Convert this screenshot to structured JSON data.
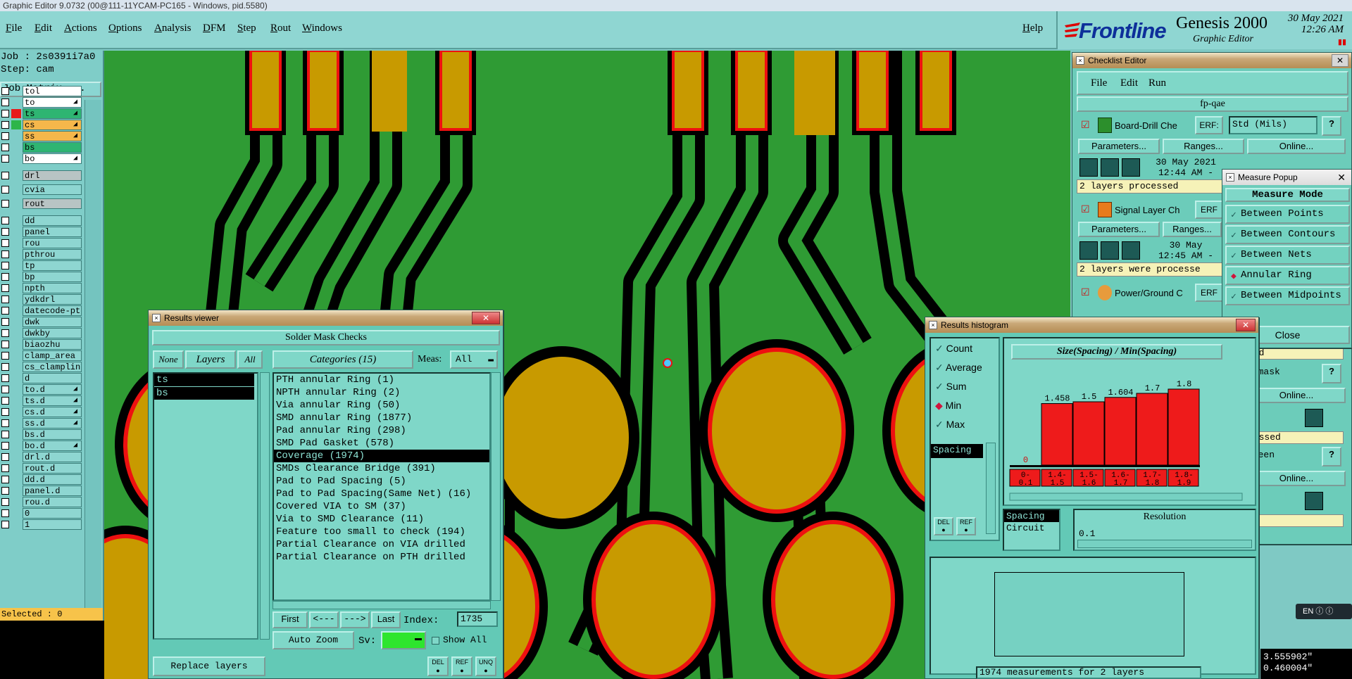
{
  "titlebar": "Graphic Editor 9.0732 (00@111-11YCAM-PC165 - Windows, pid.5580)",
  "menu": [
    "File",
    "Edit",
    "Actions",
    "Options",
    "Analysis",
    "DFM",
    "Step",
    "Rout",
    "Windows"
  ],
  "help": "Help",
  "brand": {
    "logo": "Frontline",
    "product": "Genesis 2000",
    "subtitle": "Graphic Editor",
    "date": "30 May 2021",
    "time": "12:26 AM"
  },
  "left": {
    "job": "Job : 2s0391i7a0",
    "step": "Step: cam",
    "job_matrix": "Job Matrix ...",
    "layers": [
      {
        "name": "tol",
        "style": "white",
        "swatch": ""
      },
      {
        "name": "to",
        "style": "white",
        "swatch": "",
        "arrow": true
      },
      {
        "name": "ts",
        "style": "green",
        "swatch": "#e8191a",
        "active": true,
        "arrow": true
      },
      {
        "name": "cs",
        "style": "orange",
        "swatch": "#2db54a",
        "arrow": true
      },
      {
        "name": "ss",
        "style": "orange",
        "swatch": "",
        "arrow": true
      },
      {
        "name": "bs",
        "style": "green",
        "swatch": ""
      },
      {
        "name": "bo",
        "style": "white",
        "swatch": "",
        "arrow": true
      },
      {
        "name": "drl",
        "style": "gray",
        "swatch": ""
      },
      {
        "name": "cvia",
        "style": "normal",
        "swatch": ""
      },
      {
        "name": "rout",
        "style": "gray",
        "swatch": ""
      },
      {
        "name": "dd",
        "style": "normal",
        "swatch": ""
      },
      {
        "name": "panel",
        "style": "normal",
        "swatch": ""
      },
      {
        "name": "rou",
        "style": "normal",
        "swatch": ""
      },
      {
        "name": "pthrou",
        "style": "normal",
        "swatch": ""
      },
      {
        "name": "tp",
        "style": "normal",
        "swatch": ""
      },
      {
        "name": "bp",
        "style": "normal",
        "swatch": ""
      },
      {
        "name": "npth",
        "style": "normal",
        "swatch": ""
      },
      {
        "name": "ydkdrl",
        "style": "normal",
        "swatch": ""
      },
      {
        "name": "datecode-pts",
        "style": "normal",
        "swatch": ""
      },
      {
        "name": "dwk",
        "style": "normal",
        "swatch": ""
      },
      {
        "name": "dwkby",
        "style": "normal",
        "swatch": ""
      },
      {
        "name": "biaozhu",
        "style": "normal",
        "swatch": ""
      },
      {
        "name": "clamp_area",
        "style": "normal",
        "swatch": ""
      },
      {
        "name": "cs_clampline",
        "style": "normal",
        "swatch": ""
      },
      {
        "name": "d",
        "style": "normal",
        "swatch": ""
      },
      {
        "name": "to.d",
        "style": "normal",
        "swatch": "",
        "arrow": true
      },
      {
        "name": "ts.d",
        "style": "normal",
        "swatch": "",
        "arrow": true
      },
      {
        "name": "cs.d",
        "style": "normal",
        "swatch": "",
        "arrow": true
      },
      {
        "name": "ss.d",
        "style": "normal",
        "swatch": "",
        "arrow": true
      },
      {
        "name": "bs.d",
        "style": "normal",
        "swatch": ""
      },
      {
        "name": "bo.d",
        "style": "normal",
        "swatch": "",
        "arrow": true
      },
      {
        "name": "drl.d",
        "style": "normal",
        "swatch": ""
      },
      {
        "name": "rout.d",
        "style": "normal",
        "swatch": ""
      },
      {
        "name": "dd.d",
        "style": "normal",
        "swatch": ""
      },
      {
        "name": "panel.d",
        "style": "normal",
        "swatch": ""
      },
      {
        "name": "rou.d",
        "style": "normal",
        "swatch": ""
      },
      {
        "name": "0",
        "style": "normal",
        "swatch": ""
      },
      {
        "name": "1",
        "style": "normal",
        "swatch": ""
      }
    ],
    "selected": "Selected : 0"
  },
  "results_viewer": {
    "title": "Results viewer",
    "header": "Solder Mask Checks",
    "none": "None",
    "layers": "Layers",
    "all": "All",
    "categories": "Categories (15)",
    "meas_label": "Meas:",
    "meas_value": "All",
    "layer_items": [
      "ts",
      "bs"
    ],
    "category_items": [
      "PTH annular Ring (1)",
      "NPTH annular Ring (2)",
      "Via annular Ring (50)",
      "SMD annular Ring (1877)",
      "Pad annular Ring (298)",
      "SMD Pad Gasket (578)",
      "Coverage (1974)",
      "SMDs Clearance Bridge (391)",
      "Pad to Pad Spacing (5)",
      "Pad to Pad Spacing(Same Net) (16)",
      "Covered VIA to SM (37)",
      "Via to SMD Clearance (11)",
      "Feature too small to check (194)",
      "Partial Clearance on VIA drilled",
      "Partial Clearance on PTH drilled"
    ],
    "selected_index": 6,
    "first": "First",
    "prev": "<---",
    "next": "--->",
    "last": "Last",
    "index_label": "Index:",
    "index_value": "1735",
    "auto_zoom": "Auto Zoom",
    "sv_label": "Sv:",
    "show_all": "Show All",
    "replace_layers": "Replace layers",
    "del": "DEL",
    "ref": "REF",
    "unq": "UNQ"
  },
  "checklist": {
    "title": "Checklist Editor",
    "menu": [
      "File",
      "Edit",
      "Run"
    ],
    "name": "fp-qae",
    "items": [
      {
        "label": "Board-Drill Che",
        "erf": "ERF:",
        "value": "Std (Mils)",
        "status": "2 layers processed",
        "date": "30 May 2021",
        "time": "12:44 AM -"
      },
      {
        "label": "Signal Layer Ch",
        "erf": "ERF",
        "value": "",
        "status": "2 layers were processe",
        "date": "30 May",
        "time": "12:45 AM -"
      },
      {
        "label": "Power/Ground C",
        "erf": "ERF",
        "value": "",
        "status": "",
        "date": "",
        "time": ""
      }
    ],
    "parameters": "Parameters...",
    "ranges": "Ranges...",
    "ranges_short": "Ranges",
    "online": "Online...",
    "right_fragments": [
      "sed",
      "ermask",
      "Online...",
      "cessed",
      "creen",
      "Online...",
      "d"
    ],
    "close": "Close",
    "coord1": "3.555902\"",
    "coord2": "0.460004\""
  },
  "measure": {
    "title": "Measure Popup",
    "header": "Measure Mode",
    "options": [
      {
        "label": "Between Points",
        "selected": false
      },
      {
        "label": "Between Contours",
        "selected": false
      },
      {
        "label": "Between Nets",
        "selected": false
      },
      {
        "label": "Annular Ring",
        "selected": true
      },
      {
        "label": "Between Midpoints",
        "selected": false
      }
    ]
  },
  "histogram": {
    "title": "Results histogram",
    "modes": [
      {
        "label": "Count",
        "selected": false
      },
      {
        "label": "Average",
        "selected": false
      },
      {
        "label": "Sum",
        "selected": false
      },
      {
        "label": "Min",
        "selected": true
      },
      {
        "label": "Max",
        "selected": false
      }
    ],
    "list_items": [
      "Spacing"
    ],
    "bottom_list": [
      "Spacing",
      "Circuit"
    ],
    "chart_title": "Size(Spacing) / Min(Spacing)",
    "resolution_label": "Resolution",
    "resolution_value": "0.1",
    "footer": "1974 measurements for 2 layers",
    "del": "DEL",
    "ref": "REF"
  },
  "chart_data": {
    "type": "bar",
    "title": "Size(Spacing) / Min(Spacing)",
    "categories": [
      "0-\n0.1",
      "1.4-\n1.5",
      "1.5-\n1.6",
      "1.6-\n1.7",
      "1.7-\n1.8",
      "1.8-\n1.9"
    ],
    "values": [
      0,
      1.458,
      1.5,
      1.604,
      1.7,
      1.8
    ],
    "labels": [
      "0",
      "1.458",
      "1.5",
      "1.604",
      "1.7",
      "1.8"
    ],
    "ylim": [
      0,
      2
    ],
    "bar_color": "#ee1b1b"
  },
  "taskbar": {
    "lang": "EN"
  },
  "colors": {
    "pcb_green": "#2f9b34",
    "pad_gold": "#c89a00",
    "pad_outline": "#ee1010",
    "panel": "#63c9b6"
  }
}
